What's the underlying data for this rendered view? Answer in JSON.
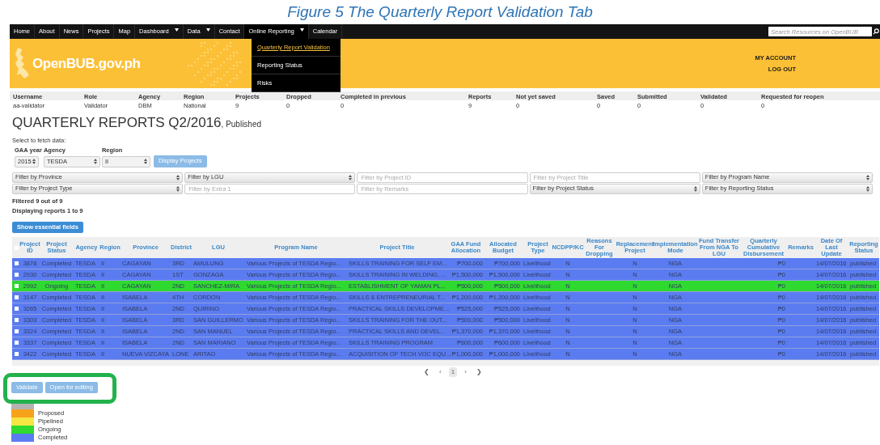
{
  "caption": "Figure 5 The Quarterly Report Validation Tab",
  "nav": {
    "items": [
      {
        "label": "Home",
        "dropdown": false
      },
      {
        "label": "About",
        "dropdown": false
      },
      {
        "label": "News",
        "dropdown": false
      },
      {
        "label": "Projects",
        "dropdown": false
      },
      {
        "label": "Map",
        "dropdown": false
      },
      {
        "label": "Dashboard",
        "dropdown": true
      },
      {
        "label": "Data",
        "dropdown": true
      },
      {
        "label": "Contact",
        "dropdown": false
      },
      {
        "label": "Online Reporting",
        "dropdown": true,
        "expanded": true
      },
      {
        "label": "Calendar",
        "dropdown": false
      }
    ],
    "search_placeholder": "Search Resources on OpenBUB",
    "menu": [
      {
        "label": "Quarterly Report Validation",
        "selected": true
      },
      {
        "label": "Reporting Status",
        "selected": false
      },
      {
        "label": "Risks",
        "selected": false
      }
    ]
  },
  "banner": {
    "logo": "OpenBUB.gov.ph",
    "links": [
      "MY ACCOUNT",
      "LOG OUT"
    ]
  },
  "user_summary": {
    "columns": [
      "Username",
      "Role",
      "Agency",
      "Region",
      "Projects",
      "Dropped",
      "Completed in previous",
      "Reports",
      "Not yet saved",
      "Saved",
      "Submitted",
      "Validated",
      "Requested for reopen"
    ],
    "values": [
      "aa-validator",
      "Validator",
      "DBM",
      "National",
      "9",
      "0",
      "0",
      "9",
      "0",
      "0",
      "0",
      "0",
      "0"
    ]
  },
  "title": "QUARTERLY REPORTS Q2/2016",
  "title_suffix": ", Published",
  "fetch": {
    "label": "Select to fetch data:",
    "fields": [
      {
        "label": "GAA year",
        "value": "2015"
      },
      {
        "label": "Agency",
        "value": "TESDA"
      },
      {
        "label": "Region",
        "value": "II"
      }
    ],
    "button": "Display Projects"
  },
  "filters": [
    {
      "kind": "select",
      "text": "Filter by Province"
    },
    {
      "kind": "select",
      "text": "Filter by LGU"
    },
    {
      "kind": "input",
      "placeholder": "Filter by Project ID"
    },
    {
      "kind": "input",
      "placeholder": "Filter by Project Title"
    },
    {
      "kind": "select",
      "text": "Filter by Program Name"
    },
    {
      "kind": "select",
      "text": "Filter by Project Type"
    },
    {
      "kind": "input",
      "placeholder": "Filter by Extra 1"
    },
    {
      "kind": "input",
      "placeholder": "Filter by Remarks"
    },
    {
      "kind": "select",
      "text": "Filter by Project Status"
    },
    {
      "kind": "select",
      "text": "Filter by Reporting Status"
    }
  ],
  "filtered": "Filtered 9 out of 9",
  "displaying": "Displaying reports 1 to 9",
  "essential_button": "Show essential fields",
  "table": {
    "header_checked": false,
    "columns": [
      "Project ID",
      "Project Status",
      "Agency",
      "Region",
      "Province",
      "District",
      "LGU",
      "Program Name",
      "Project Title",
      "GAA Fund Allocation",
      "Allocated Budget",
      "Project Type",
      "NCDPP/KC",
      "Reasons For Dropping",
      "Replacement Project",
      "Implementation Mode",
      "Fund Transfer From NGA To LGU",
      "Quarterly Cumulative Disbursement",
      "Remarks",
      "Date Of Last Update",
      "Reporting Status"
    ],
    "rows": [
      {
        "checked": false,
        "color": "#5b7cf0",
        "cells": [
          "3878",
          "Completed",
          "TESDA",
          "II",
          "CAGAYAN",
          "3RD",
          "AMULUNG",
          "Various Projects of TESDA Regio...",
          "SKILLS TRAINING FOR SELF EM...",
          "₱700,000",
          "₱700,000",
          "Livelihood",
          "N",
          "",
          "N",
          "NGA",
          "",
          "₱0",
          "",
          "14/07/2016",
          "published"
        ]
      },
      {
        "checked": false,
        "color": "#5b7cf0",
        "cells": [
          "2930",
          "Completed",
          "TESDA",
          "II",
          "CAGAYAN",
          "1ST",
          "GONZAGA",
          "Various Projects of TESDA Regio...",
          "SKILLS TRAINING IN WELDING, ...",
          "₱1,500,000",
          "₱1,500,000",
          "Livelihood",
          "N",
          "",
          "N",
          "NGA",
          "",
          "₱0",
          "",
          "14/07/2016",
          "published"
        ]
      },
      {
        "checked": false,
        "color": "#2fd92f",
        "cells": [
          "2992",
          "Ongoing",
          "TESDA",
          "II",
          "CAGAYAN",
          "2ND",
          "SANCHEZ-MIRA",
          "Various Projects of TESDA Regio...",
          "ESTABLISHMENT OF YAMAN PL...",
          "₱500,000",
          "₱500,000",
          "Livelihood",
          "N",
          "",
          "N",
          "NGA",
          "",
          "₱0",
          "",
          "14/07/2016",
          "published"
        ]
      },
      {
        "checked": false,
        "color": "#5b7cf0",
        "cells": [
          "3147",
          "Completed",
          "TESDA",
          "II",
          "ISABELA",
          "4TH",
          "CORDON",
          "Various Projects of TESDA Regio...",
          "SKILLS & ENTREPRENEURIAL T...",
          "₱1,200,000",
          "₱1,200,000",
          "Livelihood",
          "N",
          "",
          "N",
          "NGA",
          "",
          "₱0",
          "",
          "14/07/2016",
          "published"
        ]
      },
      {
        "checked": false,
        "color": "#5b7cf0",
        "cells": [
          "3265",
          "Completed",
          "TESDA",
          "II",
          "ISABELA",
          "2ND",
          "QUIRINO",
          "Various Projects of TESDA Regio...",
          "PRACTICAL SKILLS DEVELOPME...",
          "₱525,000",
          "₱525,000",
          "Livelihood",
          "N",
          "",
          "N",
          "NGA",
          "",
          "₱0",
          "",
          "14/07/2016",
          "published"
        ]
      },
      {
        "checked": false,
        "color": "#5b7cf0",
        "cells": [
          "3303",
          "Completed",
          "TESDA",
          "II",
          "ISABELA",
          "3RD",
          "SAN GUILLERMO",
          "Various Projects of TESDA Regio...",
          "SKILLS TRAINING FOR THE OUT...",
          "₱500,000",
          "₱500,000",
          "Livelihood",
          "N",
          "",
          "N",
          "NGA",
          "",
          "₱0",
          "",
          "14/07/2016",
          "published"
        ]
      },
      {
        "checked": false,
        "color": "#5b7cf0",
        "cells": [
          "3324",
          "Completed",
          "TESDA",
          "II",
          "ISABELA",
          "2ND",
          "SAN MANUEL",
          "Various Projects of TESDA Regio...",
          "PRACTICAL SKILLS AND DEVEL...",
          "₱1,370,000",
          "₱1,370,000",
          "Livelihood",
          "N",
          "",
          "N",
          "NGA",
          "",
          "₱0",
          "",
          "14/07/2016",
          "published"
        ]
      },
      {
        "checked": false,
        "color": "#5b7cf0",
        "cells": [
          "3337",
          "Completed",
          "TESDA",
          "II",
          "ISABELA",
          "2ND",
          "SAN MARIANO",
          "Various Projects of TESDA Regio...",
          "SKILLS TRAINING PROGRAM",
          "₱600,000",
          "₱600,000",
          "Livelihood",
          "N",
          "",
          "N",
          "NGA",
          "",
          "₱0",
          "",
          "14/07/2016",
          "published"
        ]
      },
      {
        "checked": false,
        "color": "#5b7cf0",
        "cells": [
          "3422",
          "Completed",
          "TESDA",
          "II",
          "NUEVA VIZCAYA",
          "LONE",
          "ARITAO",
          "Various Projects of TESDA Regio...",
          "ACQUISITION OF TECH VOC EQU...",
          "₱1,000,000",
          "₱1,000,000",
          "Livelihood",
          "N",
          "",
          "N",
          "NGA",
          "",
          "₱0",
          "",
          "14/07/2016",
          "published"
        ]
      }
    ]
  },
  "pagination": [
    {
      "label": "❮",
      "selected": false
    },
    {
      "label": "‹",
      "selected": false
    },
    {
      "label": "1",
      "selected": true
    },
    {
      "label": "›",
      "selected": false
    },
    {
      "label": "❯",
      "selected": false
    }
  ],
  "actions": [
    "Validate",
    "Open for editing"
  ],
  "legend": [
    {
      "color": "#b3b3b3"
    },
    {
      "color": "#f7a21b",
      "label": "Proposed"
    },
    {
      "color": "#f5e642",
      "label": "Pipelined"
    },
    {
      "color": "#2fd92f",
      "label": "Ongoing"
    },
    {
      "color": "#5b7cf0",
      "label": "Completed"
    }
  ]
}
